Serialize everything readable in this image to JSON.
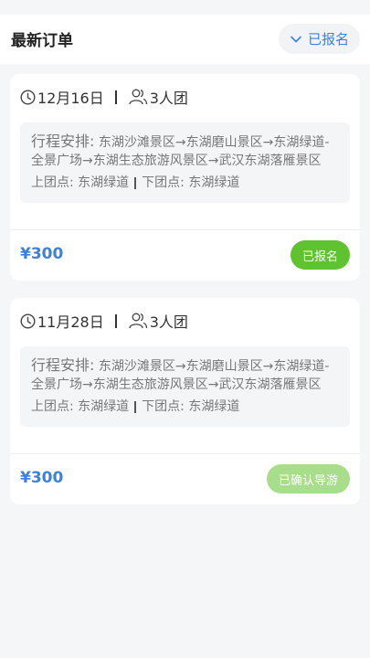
{
  "header": {
    "title": "最新订单",
    "filter_label": "已报名"
  },
  "orders": [
    {
      "date": "12月16日",
      "group": "3人团",
      "itinerary_lead": "行程安排:",
      "itinerary": "东湖沙滩景区→东湖磨山景区→东湖绿道-全景广场→东湖生态旅游风景区→武汉东湖落雁景区",
      "pickup": "上团点: 东湖绿道",
      "dropoff": "下团点: 东湖绿道",
      "price": "¥300",
      "status": "已报名",
      "status_color": "#5fc22f"
    },
    {
      "date": "11月28日",
      "group": "3人团",
      "itinerary_lead": "行程安排:",
      "itinerary": "东湖沙滩景区→东湖磨山景区→东湖绿道-全景广场→东湖生态旅游风景区→武汉东湖落雁景区",
      "pickup": "上团点: 东湖绿道",
      "dropoff": "下团点: 东湖绿道",
      "price": "¥300",
      "status": "已确认导游",
      "status_color": "#a8dd8c"
    }
  ],
  "icons": {
    "date": "clock-icon",
    "group": "people-icon",
    "filter": "chevron-down-icon"
  }
}
